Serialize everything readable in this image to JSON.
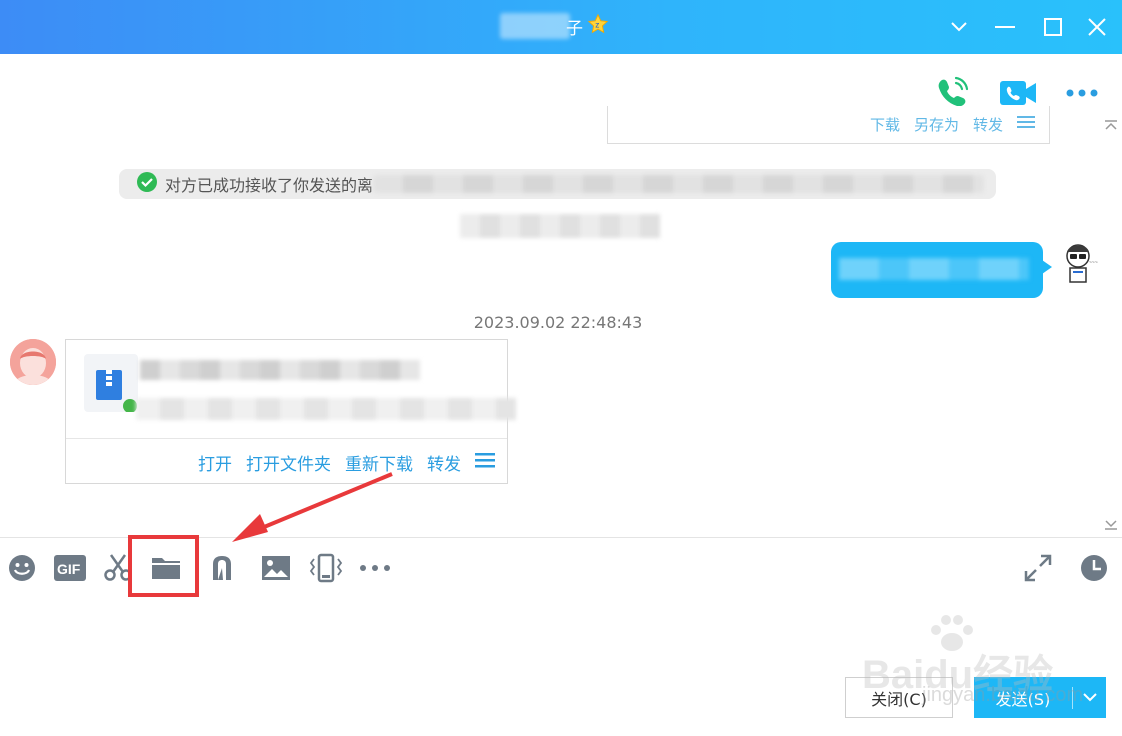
{
  "window": {
    "title_suffix": "子",
    "buttons": [
      "chevron-down",
      "minimize",
      "maximize",
      "close"
    ]
  },
  "header_actions": [
    "voice-call-icon",
    "video-call-icon",
    "more-icon"
  ],
  "messages": {
    "prev_file_actions": [
      "下载",
      "另存为",
      "转发"
    ],
    "system_notice": "对方已成功接收了你发送的离",
    "timestamp": "2023.09.02 22:48:43",
    "file_card": {
      "actions": [
        "打开",
        "打开文件夹",
        "重新下载",
        "转发"
      ]
    }
  },
  "toolbar": {
    "gif_label": "GIF",
    "items": [
      "emoji-icon",
      "gif-icon",
      "scissors-icon",
      "folder-icon",
      "music-icon",
      "image-icon",
      "shake-icon",
      "more-icon"
    ],
    "right_items": [
      "expand-icon",
      "history-clock-icon"
    ]
  },
  "footer": {
    "close_label": "关闭(C)",
    "send_label": "发送(S)"
  },
  "watermark": {
    "text": "Baidu经验",
    "url": "jingyan.baidu.com"
  },
  "colors": {
    "titlebar_start": "#3d8cf6",
    "titlebar_end": "#29c1fb",
    "accent": "#1db7f6",
    "link": "#2a9de0",
    "highlight": "#e8393b"
  }
}
